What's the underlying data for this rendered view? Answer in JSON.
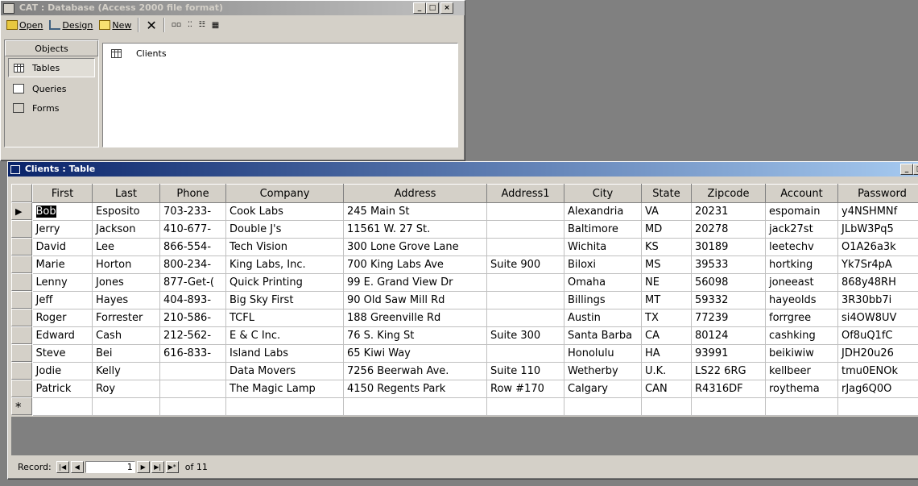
{
  "db_window": {
    "title": "CAT : Database (Access 2000 file format)",
    "toolbar": {
      "open": "Open",
      "design": "Design",
      "new": "New"
    },
    "objects_header": "Objects",
    "objects": [
      "Tables",
      "Queries",
      "Forms"
    ],
    "list_items": [
      "Clients"
    ]
  },
  "table_window": {
    "title": "Clients : Table",
    "columns": [
      "First",
      "Last",
      "Phone",
      "Company",
      "Address",
      "Address1",
      "City",
      "State",
      "Zipcode",
      "Account",
      "Password"
    ],
    "rows": [
      [
        "Bob",
        "Esposito",
        "703-233-",
        "Cook Labs",
        "245 Main St",
        "",
        "Alexandria",
        "VA",
        "20231",
        "espomain",
        "y4NSHMNf"
      ],
      [
        "Jerry",
        "Jackson",
        "410-677-",
        "Double J's",
        "11561 W. 27 St.",
        "",
        "Baltimore",
        "MD",
        "20278",
        "jack27st",
        "JLbW3Pq5"
      ],
      [
        "David",
        "Lee",
        "866-554-",
        "Tech Vision",
        "300 Lone Grove Lane",
        "",
        "Wichita",
        "KS",
        "30189",
        "leetechv",
        "O1A26a3k"
      ],
      [
        "Marie",
        "Horton",
        "800-234-",
        "King Labs, Inc.",
        "700 King Labs Ave",
        "Suite 900",
        "Biloxi",
        "MS",
        "39533",
        "hortking",
        "Yk7Sr4pA"
      ],
      [
        "Lenny",
        "Jones",
        "877-Get-(",
        "Quick Printing",
        "99 E. Grand View Dr",
        "",
        "Omaha",
        "NE",
        "56098",
        "joneeast",
        "868y48RH"
      ],
      [
        "Jeff",
        "Hayes",
        "404-893-",
        "Big Sky First",
        "90 Old Saw Mill Rd",
        "",
        "Billings",
        "MT",
        "59332",
        "hayeolds",
        "3R30bb7i"
      ],
      [
        "Roger",
        "Forrester",
        "210-586-",
        "TCFL",
        "188 Greenville Rd",
        "",
        "Austin",
        "TX",
        "77239",
        "forrgree",
        "si4OW8UV"
      ],
      [
        "Edward",
        "Cash",
        "212-562-",
        "E & C Inc.",
        "76 S. King St",
        "Suite 300",
        "Santa Barba",
        "CA",
        "80124",
        "cashking",
        "Of8uQ1fC"
      ],
      [
        "Steve",
        "Bei",
        "616-833-",
        "Island Labs",
        "65 Kiwi Way",
        "",
        "Honolulu",
        "HA",
        "93991",
        "beikiwiw",
        "JDH20u26"
      ],
      [
        "Jodie",
        "Kelly",
        "",
        "Data Movers",
        "7256 Beerwah Ave.",
        "Suite 110",
        "Wetherby",
        "U.K.",
        "LS22 6RG",
        "kellbeer",
        "tmu0ENOk"
      ],
      [
        "Patrick",
        "Roy",
        "",
        "The Magic Lamp",
        "4150 Regents Park",
        "Row #170",
        "Calgary",
        "CAN",
        "R4316DF",
        "roythema",
        "rJag6Q0O"
      ]
    ],
    "new_row_marker": "*",
    "current_row_marker": "▶",
    "record_label": "Record:",
    "record_current": "1",
    "record_of": "of 11"
  }
}
